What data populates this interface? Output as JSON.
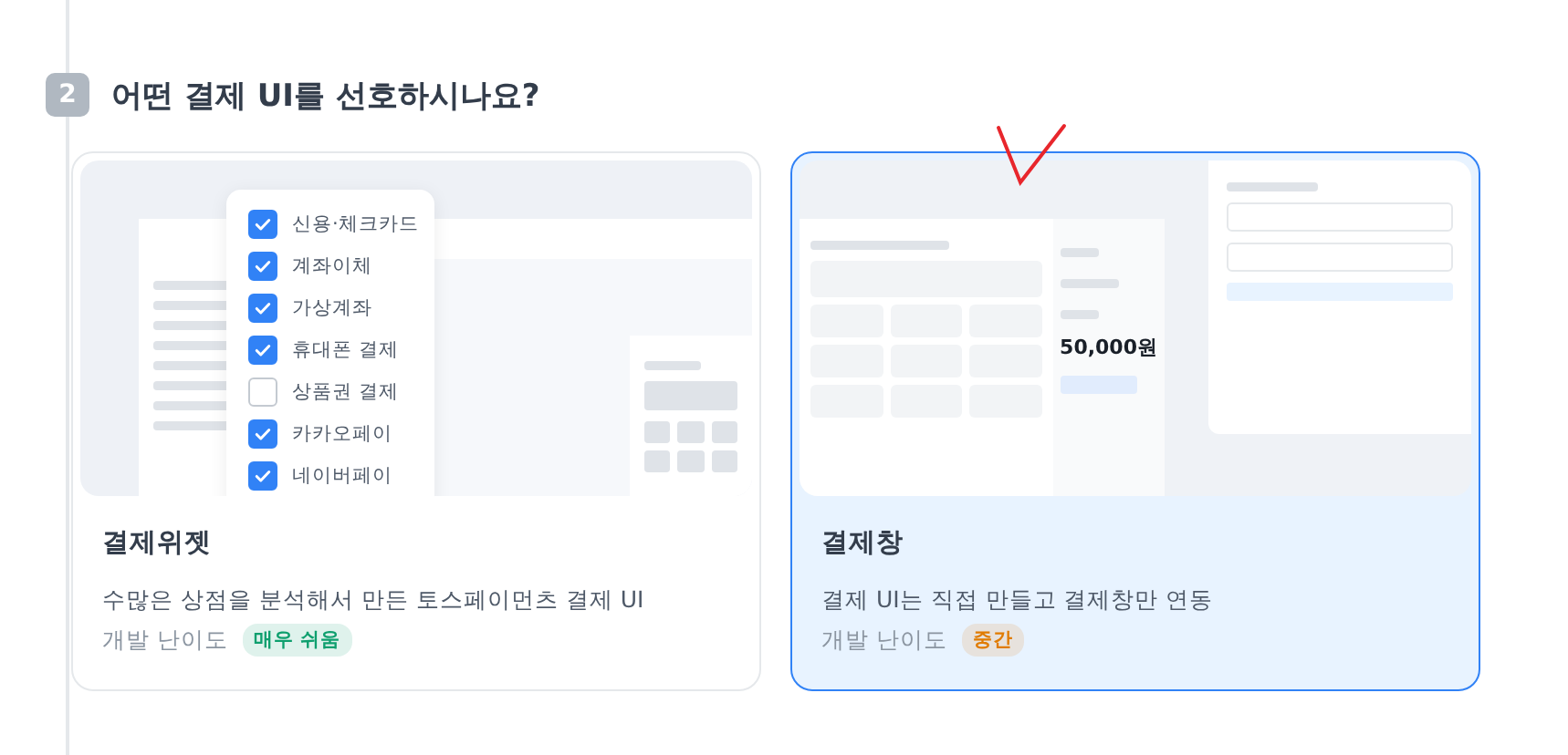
{
  "step": {
    "number": "2",
    "title": "어떤 결제 UI를 선호하시나요?"
  },
  "options": [
    {
      "kind": "widget",
      "selected": false,
      "title": "결제위젯",
      "description": "수많은 상점을 분석해서 만든 토스페이먼츠 결제 UI",
      "difficulty_label": "개발 난이도",
      "difficulty": {
        "text": "매우 쉬움",
        "color": "#0e9f6e"
      },
      "preview": {
        "methods": [
          {
            "label": "신용·체크카드",
            "checked": true
          },
          {
            "label": "계좌이체",
            "checked": true
          },
          {
            "label": "가상계좌",
            "checked": true
          },
          {
            "label": "휴대폰 결제",
            "checked": true
          },
          {
            "label": "상품권 결제",
            "checked": false
          },
          {
            "label": "카카오페이",
            "checked": true
          },
          {
            "label": "네이버페이",
            "checked": true
          }
        ]
      }
    },
    {
      "kind": "window",
      "selected": true,
      "title": "결제창",
      "description": "결제 UI는 직접 만들고 결제창만 연동",
      "difficulty_label": "개발 난이도",
      "difficulty": {
        "text": "중간",
        "color": "#e07b00"
      },
      "preview": {
        "amount": "50,000원"
      }
    }
  ]
}
